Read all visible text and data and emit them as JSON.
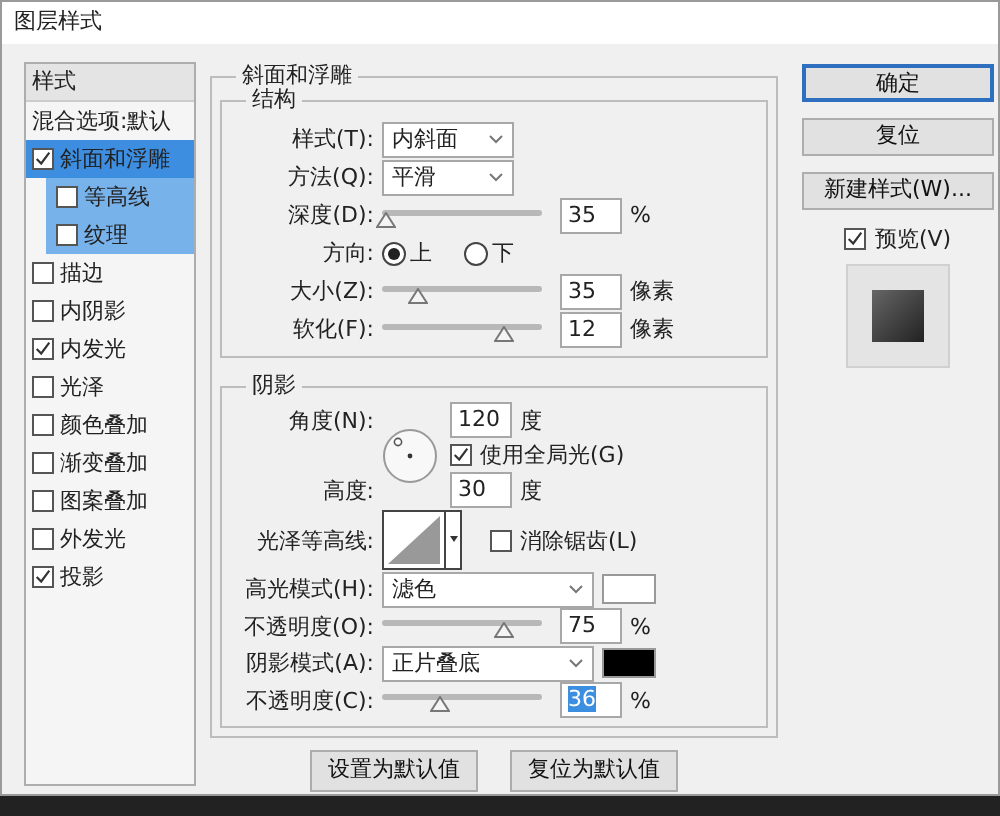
{
  "window": {
    "title": "图层样式"
  },
  "sidebar": {
    "header": "样式",
    "items": [
      {
        "kind": "plain",
        "label": "混合选项:默认",
        "selected": false
      },
      {
        "kind": "check",
        "label": "斜面和浮雕",
        "checked": true,
        "selected": true
      },
      {
        "kind": "sub",
        "label": "等高线",
        "checked": false,
        "selected": false
      },
      {
        "kind": "sub",
        "label": "纹理",
        "checked": false,
        "selected": false
      },
      {
        "kind": "check",
        "label": "描边",
        "checked": false,
        "selected": false
      },
      {
        "kind": "check",
        "label": "内阴影",
        "checked": false,
        "selected": false
      },
      {
        "kind": "check",
        "label": "内发光",
        "checked": true,
        "selected": false
      },
      {
        "kind": "check",
        "label": "光泽",
        "checked": false,
        "selected": false
      },
      {
        "kind": "check",
        "label": "颜色叠加",
        "checked": false,
        "selected": false
      },
      {
        "kind": "check",
        "label": "渐变叠加",
        "checked": false,
        "selected": false
      },
      {
        "kind": "check",
        "label": "图案叠加",
        "checked": false,
        "selected": false
      },
      {
        "kind": "check",
        "label": "外发光",
        "checked": false,
        "selected": false
      },
      {
        "kind": "check",
        "label": "投影",
        "checked": true,
        "selected": false
      }
    ]
  },
  "bevel": {
    "title": "斜面和浮雕",
    "structure": {
      "title": "结构",
      "rows": [
        {
          "kind": "select",
          "label": "样式(T):",
          "value": "内斜面"
        },
        {
          "kind": "select",
          "label": "方法(Q):",
          "value": "平滑"
        },
        {
          "kind": "slider",
          "label": "深度(D):",
          "level": 0.03,
          "value": "35",
          "unit": "%",
          "value_selected": false
        },
        {
          "kind": "radio",
          "label": "方向:",
          "options": [
            {
              "label": "上",
              "selected": true
            },
            {
              "label": "下",
              "selected": false
            }
          ]
        },
        {
          "kind": "slider",
          "label": "大小(Z):",
          "level": 0.22,
          "value": "35",
          "unit": "像素",
          "value_selected": false
        },
        {
          "kind": "slider",
          "label": "软化(F):",
          "level": 0.76,
          "value": "12",
          "unit": "像素",
          "value_selected": false
        }
      ]
    },
    "shading": {
      "title": "阴影",
      "angle": {
        "label": "角度(N):",
        "value": "120",
        "unit": "度"
      },
      "global_light": {
        "label": "使用全局光(G)",
        "checked": true
      },
      "altitude": {
        "label": "高度:",
        "value": "30",
        "unit": "度"
      },
      "gloss_contour": {
        "label": "光泽等高线:"
      },
      "anti_alias": {
        "label": "消除锯齿(L)",
        "checked": false
      },
      "rows": [
        {
          "kind": "select",
          "label": "高光模式(H):",
          "value": "滤色",
          "color": "#ffffff"
        },
        {
          "kind": "slider",
          "label": "不透明度(O):",
          "level": 0.76,
          "value": "75",
          "unit": "%",
          "value_selected": false
        },
        {
          "kind": "select",
          "label": "阴影模式(A):",
          "value": "正片叠底",
          "color": "#000000"
        },
        {
          "kind": "slider",
          "label": "不透明度(C):",
          "level": 0.36,
          "value": "36",
          "unit": "%",
          "value_selected": true
        }
      ]
    }
  },
  "bottom_buttons": [
    "设置为默认值",
    "复位为默认值"
  ],
  "side_buttons": [
    {
      "label": "确定",
      "default": true
    },
    {
      "label": "复位",
      "default": false
    },
    {
      "label": "新建样式(W)...",
      "default": false
    }
  ],
  "preview": {
    "label": "预览(V)",
    "checked": true
  }
}
